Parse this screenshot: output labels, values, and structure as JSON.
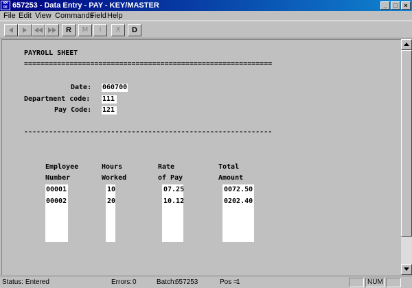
{
  "window": {
    "app_icon": "KM DE",
    "title": "657253 - Data Entry  - PAY - KEY/MASTER",
    "controls": [
      "_",
      "□",
      "×"
    ]
  },
  "menu": [
    "File",
    "Edit",
    "View",
    "Commands",
    "Field",
    "Help"
  ],
  "toolbar": {
    "record_label": "R",
    "m_label": "M",
    "i_label": "I",
    "x_label": "X",
    "delete_label": "D"
  },
  "form": {
    "heading": "PAYROLL SHEET",
    "double_rule": "============================================================",
    "single_rule": "------------------------------------------------------------",
    "date_label": "Date:",
    "date_value": "060700",
    "dept_label": "Department code:",
    "dept_value": "111",
    "paycode_label": "Pay Code:",
    "paycode_value": "121",
    "columns": [
      {
        "line1": "Employee",
        "line2": "Number"
      },
      {
        "line1": "Hours",
        "line2": "Worked"
      },
      {
        "line1": "Rate",
        "line2": "of Pay"
      },
      {
        "line1": "Total",
        "line2": "Amount"
      }
    ],
    "rows": [
      {
        "employee": "00001",
        "hours": "10",
        "rate": "07.25",
        "total": "0072.50"
      },
      {
        "employee": "00002",
        "hours": "20",
        "rate": "10.12",
        "total": "0202.40"
      }
    ]
  },
  "status": {
    "status_text": "Status: Entered",
    "errors_label": "Errors:",
    "errors_value": "0",
    "batch_label": "Batch:",
    "batch_value": "657253",
    "pos_label": "Pos =",
    "pos_value": "1",
    "num_indicator": "NUM"
  }
}
